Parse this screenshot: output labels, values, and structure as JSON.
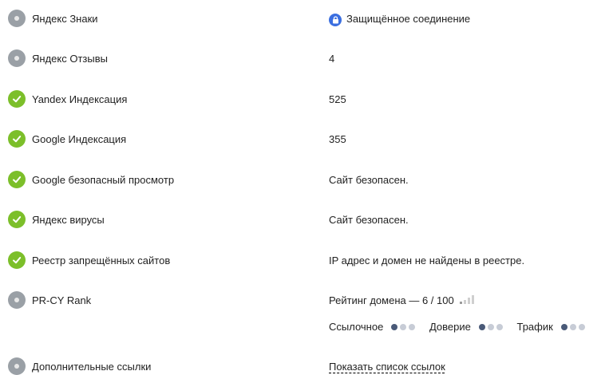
{
  "rows": [
    {
      "label": "Яндекс Знаки",
      "status": "neutral",
      "value": "Защищённое соединение",
      "value_icon": "lock-icon"
    },
    {
      "label": "Яндекс Отзывы",
      "status": "neutral",
      "value": "4"
    },
    {
      "label": "Yandex Индексация",
      "status": "ok",
      "value": "525"
    },
    {
      "label": "Google Индексация",
      "status": "ok",
      "value": "355"
    },
    {
      "label": "Google безопасный просмотр",
      "status": "ok",
      "value": "Сайт безопасен."
    },
    {
      "label": "Яндекс вирусы",
      "status": "ok",
      "value": "Сайт безопасен."
    },
    {
      "label": "Реестр запрещённых сайтов",
      "status": "ok",
      "value": "IP адрес и домен не найдены в реестре."
    },
    {
      "label": "PR-CY Rank",
      "status": "neutral",
      "value": "Рейтинг домена — 6 / 100"
    },
    {
      "label": "Дополнительные ссылки",
      "status": "neutral",
      "value": "Показать список ссылок"
    }
  ],
  "rank": {
    "signal_level": 1,
    "signal_max": 4,
    "metrics": [
      {
        "label": "Ссылочное",
        "level": 1,
        "max": 3
      },
      {
        "label": "Доверие",
        "level": 1,
        "max": 3
      },
      {
        "label": "Трафик",
        "level": 1,
        "max": 3
      }
    ]
  },
  "colors": {
    "ok": "#7cbf2a",
    "neutral": "#9aa0a6",
    "lock": "#3b6fe0",
    "dot_active": "#4a5a78",
    "dot_inactive": "#c7ccd6"
  }
}
